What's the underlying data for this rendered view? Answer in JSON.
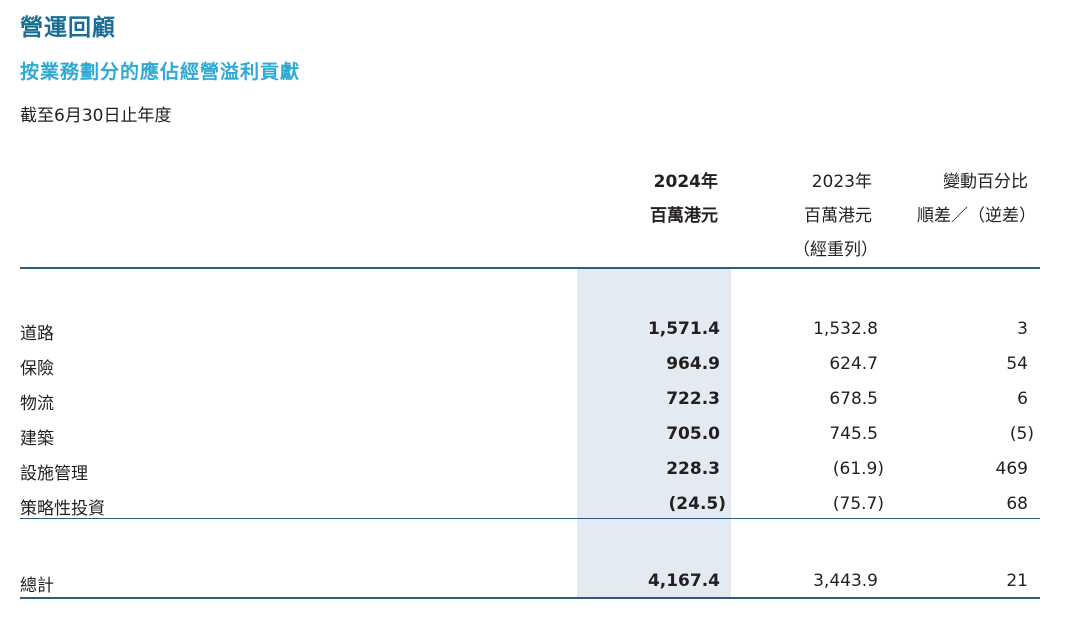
{
  "title": "營運回顧",
  "subtitle": "按業務劃分的應佔經營溢利貢獻",
  "period": "截至6月30日止年度",
  "header": {
    "col2024_year": "2024年",
    "col2024_unit": "百萬港元",
    "col2023_year": "2023年",
    "col2023_unit": "百萬港元",
    "col2023_note": "（經重列）",
    "change_line1": "變動百分比",
    "change_line2": "順差／（逆差）"
  },
  "rows": [
    {
      "label": "道路",
      "v2024": "1,571.4",
      "v2023": "1,532.8",
      "change": "3"
    },
    {
      "label": "保險",
      "v2024": "964.9",
      "v2023": "624.7",
      "change": "54"
    },
    {
      "label": "物流",
      "v2024": "722.3",
      "v2023": "678.5",
      "change": "6"
    },
    {
      "label": "建築",
      "v2024": "705.0",
      "v2023": "745.5",
      "change": "(5)"
    },
    {
      "label": "設施管理",
      "v2024": "228.3",
      "v2023": "(61.9)",
      "change": "469"
    },
    {
      "label": "策略性投資",
      "v2024": "(24.5)",
      "v2023": "(75.7)",
      "change": "68"
    }
  ],
  "total": {
    "label": "總計",
    "v2024": "4,167.4",
    "v2023": "3,443.9",
    "change": "21"
  }
}
